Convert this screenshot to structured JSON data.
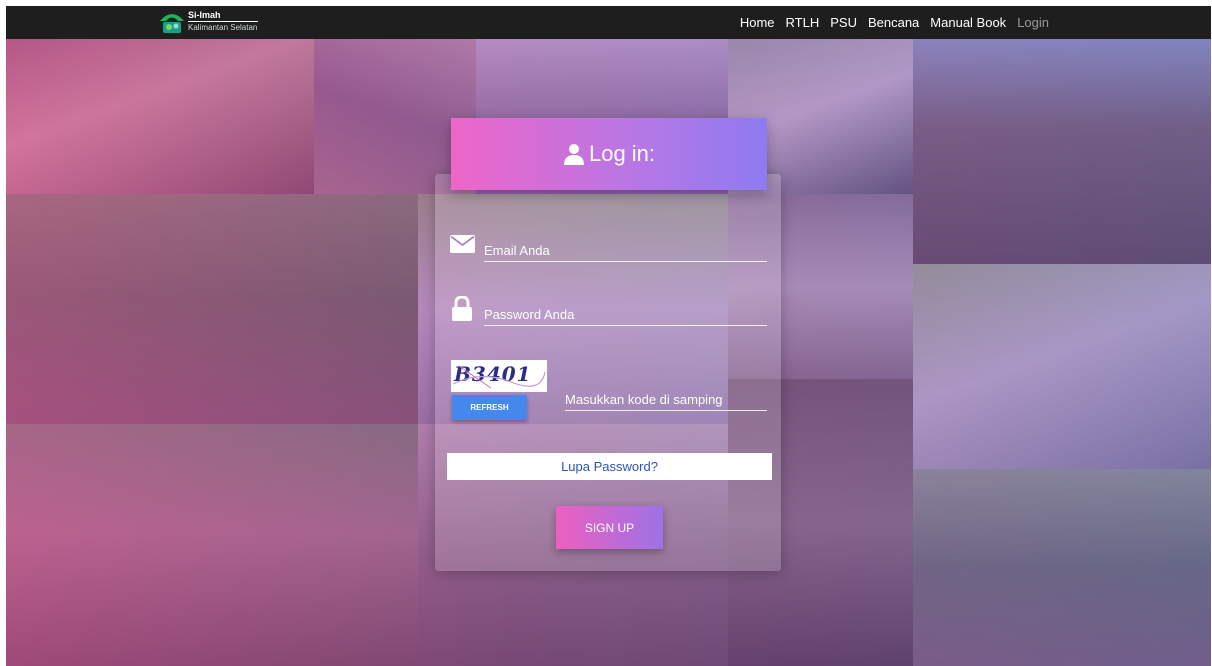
{
  "navbar": {
    "brand_name": "Si-Imah",
    "brand_region": "Kalimantan Selatan",
    "links": [
      {
        "label": "Home"
      },
      {
        "label": "RTLH"
      },
      {
        "label": "PSU"
      },
      {
        "label": "Bencana"
      },
      {
        "label": "Manual Book"
      },
      {
        "label": "Login"
      }
    ]
  },
  "login": {
    "title": "Log in:",
    "email_placeholder": "Email Anda",
    "password_placeholder": "Password Anda",
    "captcha_text": "B3401",
    "captcha_refresh_label": "REFRESH",
    "captcha_placeholder": "Masukkan kode di samping",
    "forgot_label": "Lupa Password?",
    "submit_label": "SIGN UP"
  },
  "icons": {
    "user": "user-icon",
    "email": "envelope-icon",
    "password": "lock-icon"
  },
  "colors": {
    "navbar_bg": "#1e1e1e",
    "header_gradient_start": "#ee66c8",
    "header_gradient_end": "#8d7bf0",
    "refresh_button": "#4488ee",
    "forgot_text": "#2a56b8",
    "nav_active_muted": "#9a9a9a"
  }
}
